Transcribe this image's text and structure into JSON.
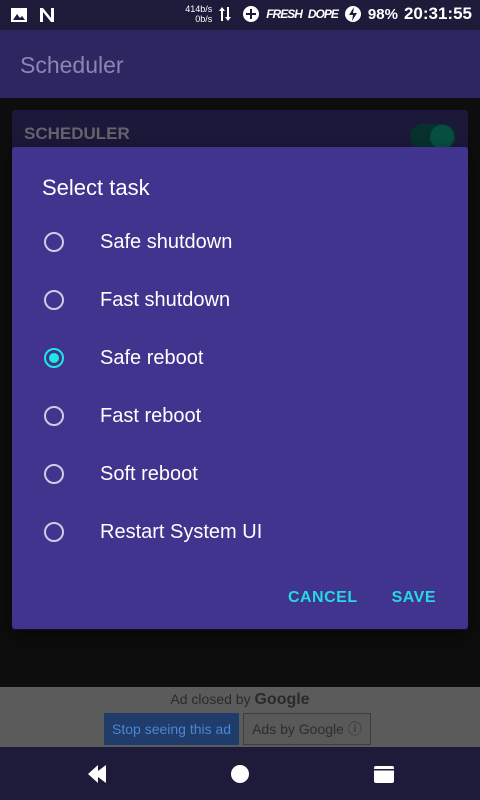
{
  "status_bar": {
    "speed_up": "414b/s",
    "speed_down": "0b/s",
    "tag_1": "FRESH",
    "tag_2": "DOPE",
    "battery": "98%",
    "time": "20:31:55"
  },
  "app_bar": {
    "title": "Scheduler"
  },
  "card": {
    "title": "SCHEDULER",
    "toggle_on": true
  },
  "dialog": {
    "title": "Select task",
    "options": [
      {
        "label": "Safe shutdown",
        "checked": false
      },
      {
        "label": "Fast shutdown",
        "checked": false
      },
      {
        "label": "Safe reboot",
        "checked": true
      },
      {
        "label": "Fast reboot",
        "checked": false
      },
      {
        "label": "Soft reboot",
        "checked": false
      },
      {
        "label": "Restart System UI",
        "checked": false
      }
    ],
    "cancel_label": "CANCEL",
    "save_label": "SAVE"
  },
  "ad": {
    "closed_text": "Ad closed by",
    "closed_brand": "Google",
    "stop_label": "Stop seeing this ad",
    "ads_by_label": "Ads by Google ⓘ"
  },
  "colors": {
    "dialog_bg": "#41348e",
    "accent": "#1de9e0",
    "app_bar": "#2e2660"
  },
  "icons": {
    "status_left": [
      "image-icon",
      "n-notification-icon"
    ],
    "status_right": [
      "data-arrows-icon",
      "plus-circle-icon",
      "flash-icon"
    ],
    "nav": [
      "back-icon",
      "home-icon",
      "recents-icon"
    ]
  }
}
